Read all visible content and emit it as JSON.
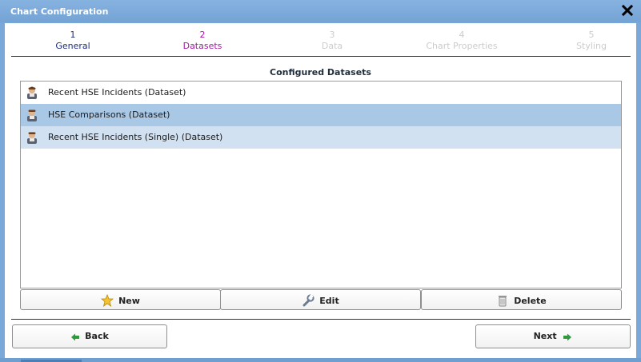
{
  "window": {
    "title": "Chart Configuration"
  },
  "steps": [
    {
      "number": "1",
      "label": "General"
    },
    {
      "number": "2",
      "label": "Datasets"
    },
    {
      "number": "3",
      "label": "Data"
    },
    {
      "number": "4",
      "label": "Chart Properties"
    },
    {
      "number": "5",
      "label": "Styling"
    }
  ],
  "section_title": "Configured Datasets",
  "datasets": [
    {
      "label": "Recent HSE Incidents (Dataset)",
      "icon": "user-dataset-icon"
    },
    {
      "label": "HSE Comparisons (Dataset)",
      "icon": "user-dataset-icon",
      "selected": true
    },
    {
      "label": "Recent HSE Incidents (Single) (Dataset)",
      "icon": "user-dataset-icon"
    }
  ],
  "actions": {
    "new": "New",
    "edit": "Edit",
    "delete": "Delete"
  },
  "nav": {
    "back": "Back",
    "next": "Next"
  },
  "colors": {
    "window_frame": "#7aa9d9",
    "active_step": "#a318a3",
    "completed_step": "#1c2c7c",
    "disabled_step": "#cccccc",
    "selected_row": "#a9c8e6",
    "alt_row": "#d2e1f1"
  }
}
